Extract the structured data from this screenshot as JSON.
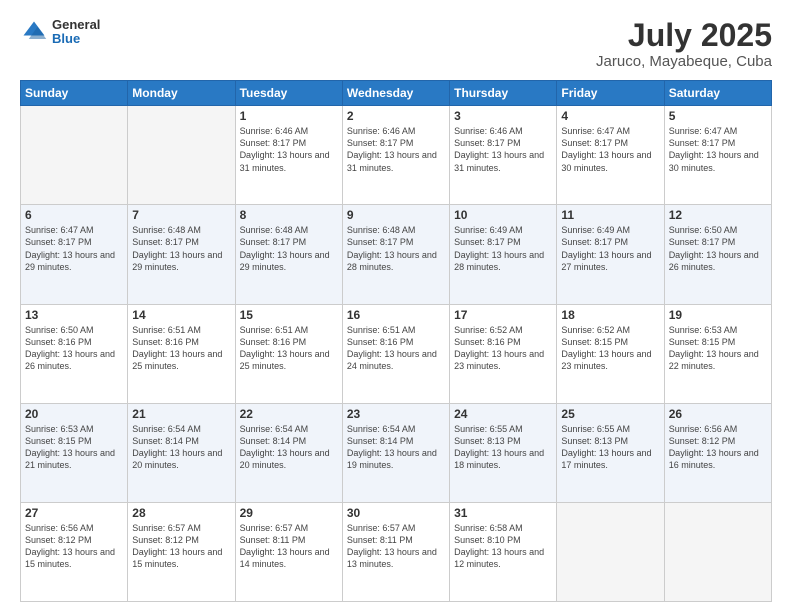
{
  "header": {
    "logo_general": "General",
    "logo_blue": "Blue",
    "title": "July 2025",
    "subtitle": "Jaruco, Mayabeque, Cuba"
  },
  "days_of_week": [
    "Sunday",
    "Monday",
    "Tuesday",
    "Wednesday",
    "Thursday",
    "Friday",
    "Saturday"
  ],
  "weeks": [
    [
      {
        "day": "",
        "sunrise": "",
        "sunset": "",
        "daylight": ""
      },
      {
        "day": "",
        "sunrise": "",
        "sunset": "",
        "daylight": ""
      },
      {
        "day": "1",
        "sunrise": "Sunrise: 6:46 AM",
        "sunset": "Sunset: 8:17 PM",
        "daylight": "Daylight: 13 hours and 31 minutes."
      },
      {
        "day": "2",
        "sunrise": "Sunrise: 6:46 AM",
        "sunset": "Sunset: 8:17 PM",
        "daylight": "Daylight: 13 hours and 31 minutes."
      },
      {
        "day": "3",
        "sunrise": "Sunrise: 6:46 AM",
        "sunset": "Sunset: 8:17 PM",
        "daylight": "Daylight: 13 hours and 31 minutes."
      },
      {
        "day": "4",
        "sunrise": "Sunrise: 6:47 AM",
        "sunset": "Sunset: 8:17 PM",
        "daylight": "Daylight: 13 hours and 30 minutes."
      },
      {
        "day": "5",
        "sunrise": "Sunrise: 6:47 AM",
        "sunset": "Sunset: 8:17 PM",
        "daylight": "Daylight: 13 hours and 30 minutes."
      }
    ],
    [
      {
        "day": "6",
        "sunrise": "Sunrise: 6:47 AM",
        "sunset": "Sunset: 8:17 PM",
        "daylight": "Daylight: 13 hours and 29 minutes."
      },
      {
        "day": "7",
        "sunrise": "Sunrise: 6:48 AM",
        "sunset": "Sunset: 8:17 PM",
        "daylight": "Daylight: 13 hours and 29 minutes."
      },
      {
        "day": "8",
        "sunrise": "Sunrise: 6:48 AM",
        "sunset": "Sunset: 8:17 PM",
        "daylight": "Daylight: 13 hours and 29 minutes."
      },
      {
        "day": "9",
        "sunrise": "Sunrise: 6:48 AM",
        "sunset": "Sunset: 8:17 PM",
        "daylight": "Daylight: 13 hours and 28 minutes."
      },
      {
        "day": "10",
        "sunrise": "Sunrise: 6:49 AM",
        "sunset": "Sunset: 8:17 PM",
        "daylight": "Daylight: 13 hours and 28 minutes."
      },
      {
        "day": "11",
        "sunrise": "Sunrise: 6:49 AM",
        "sunset": "Sunset: 8:17 PM",
        "daylight": "Daylight: 13 hours and 27 minutes."
      },
      {
        "day": "12",
        "sunrise": "Sunrise: 6:50 AM",
        "sunset": "Sunset: 8:17 PM",
        "daylight": "Daylight: 13 hours and 26 minutes."
      }
    ],
    [
      {
        "day": "13",
        "sunrise": "Sunrise: 6:50 AM",
        "sunset": "Sunset: 8:16 PM",
        "daylight": "Daylight: 13 hours and 26 minutes."
      },
      {
        "day": "14",
        "sunrise": "Sunrise: 6:51 AM",
        "sunset": "Sunset: 8:16 PM",
        "daylight": "Daylight: 13 hours and 25 minutes."
      },
      {
        "day": "15",
        "sunrise": "Sunrise: 6:51 AM",
        "sunset": "Sunset: 8:16 PM",
        "daylight": "Daylight: 13 hours and 25 minutes."
      },
      {
        "day": "16",
        "sunrise": "Sunrise: 6:51 AM",
        "sunset": "Sunset: 8:16 PM",
        "daylight": "Daylight: 13 hours and 24 minutes."
      },
      {
        "day": "17",
        "sunrise": "Sunrise: 6:52 AM",
        "sunset": "Sunset: 8:16 PM",
        "daylight": "Daylight: 13 hours and 23 minutes."
      },
      {
        "day": "18",
        "sunrise": "Sunrise: 6:52 AM",
        "sunset": "Sunset: 8:15 PM",
        "daylight": "Daylight: 13 hours and 23 minutes."
      },
      {
        "day": "19",
        "sunrise": "Sunrise: 6:53 AM",
        "sunset": "Sunset: 8:15 PM",
        "daylight": "Daylight: 13 hours and 22 minutes."
      }
    ],
    [
      {
        "day": "20",
        "sunrise": "Sunrise: 6:53 AM",
        "sunset": "Sunset: 8:15 PM",
        "daylight": "Daylight: 13 hours and 21 minutes."
      },
      {
        "day": "21",
        "sunrise": "Sunrise: 6:54 AM",
        "sunset": "Sunset: 8:14 PM",
        "daylight": "Daylight: 13 hours and 20 minutes."
      },
      {
        "day": "22",
        "sunrise": "Sunrise: 6:54 AM",
        "sunset": "Sunset: 8:14 PM",
        "daylight": "Daylight: 13 hours and 20 minutes."
      },
      {
        "day": "23",
        "sunrise": "Sunrise: 6:54 AM",
        "sunset": "Sunset: 8:14 PM",
        "daylight": "Daylight: 13 hours and 19 minutes."
      },
      {
        "day": "24",
        "sunrise": "Sunrise: 6:55 AM",
        "sunset": "Sunset: 8:13 PM",
        "daylight": "Daylight: 13 hours and 18 minutes."
      },
      {
        "day": "25",
        "sunrise": "Sunrise: 6:55 AM",
        "sunset": "Sunset: 8:13 PM",
        "daylight": "Daylight: 13 hours and 17 minutes."
      },
      {
        "day": "26",
        "sunrise": "Sunrise: 6:56 AM",
        "sunset": "Sunset: 8:12 PM",
        "daylight": "Daylight: 13 hours and 16 minutes."
      }
    ],
    [
      {
        "day": "27",
        "sunrise": "Sunrise: 6:56 AM",
        "sunset": "Sunset: 8:12 PM",
        "daylight": "Daylight: 13 hours and 15 minutes."
      },
      {
        "day": "28",
        "sunrise": "Sunrise: 6:57 AM",
        "sunset": "Sunset: 8:12 PM",
        "daylight": "Daylight: 13 hours and 15 minutes."
      },
      {
        "day": "29",
        "sunrise": "Sunrise: 6:57 AM",
        "sunset": "Sunset: 8:11 PM",
        "daylight": "Daylight: 13 hours and 14 minutes."
      },
      {
        "day": "30",
        "sunrise": "Sunrise: 6:57 AM",
        "sunset": "Sunset: 8:11 PM",
        "daylight": "Daylight: 13 hours and 13 minutes."
      },
      {
        "day": "31",
        "sunrise": "Sunrise: 6:58 AM",
        "sunset": "Sunset: 8:10 PM",
        "daylight": "Daylight: 13 hours and 12 minutes."
      },
      {
        "day": "",
        "sunrise": "",
        "sunset": "",
        "daylight": ""
      },
      {
        "day": "",
        "sunrise": "",
        "sunset": "",
        "daylight": ""
      }
    ]
  ]
}
